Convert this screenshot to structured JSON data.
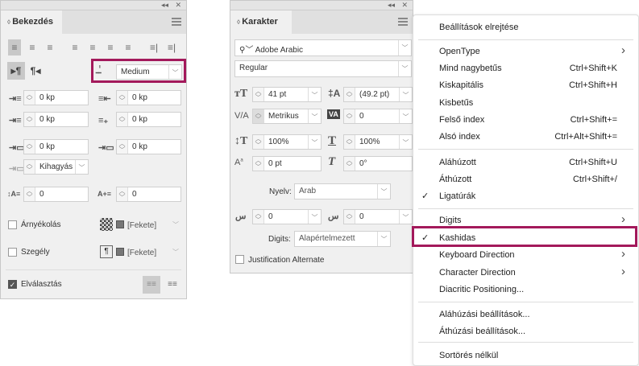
{
  "paragraph_panel": {
    "title": "Bekezdés",
    "kashida_value": "Medium",
    "left_indent": "0 kp",
    "right_indent": "0 kp",
    "first_line_indent": "0 kp",
    "last_line_indent": "0 kp",
    "space_before": "0 kp",
    "space_after": "0 kp",
    "grid_align": "Kihagyás",
    "drop_cap_lines": "0",
    "drop_cap_chars": "0",
    "shading_label": "Árnyékolás",
    "shading_color": "[Fekete]",
    "border_label": "Szegély",
    "border_color": "[Fekete]",
    "hyphenation_label": "Elválasztás"
  },
  "character_panel": {
    "title": "Karakter",
    "font_family": "Adobe Arabic",
    "font_style": "Regular",
    "font_size": "41 pt",
    "leading": "(49.2 pt)",
    "kerning": "Metrikus",
    "tracking": "0",
    "vertical_scale": "100%",
    "horizontal_scale": "100%",
    "baseline_shift": "0 pt",
    "skew": "0°",
    "language_label": "Nyelv:",
    "language": "Arab",
    "diacritic_x": "0",
    "diacritic_y": "0",
    "digits_label": "Digits:",
    "digits": "Alapértelmezett",
    "justification_alternate": "Justification Alternate"
  },
  "menu": {
    "items": [
      {
        "label": "Beállítások elrejtése",
        "shortcut": "",
        "submenu": false,
        "checked": false
      },
      {
        "label": "OpenType",
        "shortcut": "",
        "submenu": true,
        "checked": false
      },
      {
        "label": "Mind nagybetűs",
        "shortcut": "Ctrl+Shift+K",
        "submenu": false,
        "checked": false
      },
      {
        "label": "Kiskapitális",
        "shortcut": "Ctrl+Shift+H",
        "submenu": false,
        "checked": false
      },
      {
        "label": "Kisbetűs",
        "shortcut": "",
        "submenu": false,
        "checked": false
      },
      {
        "label": "Felső index",
        "shortcut": "Ctrl+Shift+=",
        "submenu": false,
        "checked": false
      },
      {
        "label": "Alsó index",
        "shortcut": "Ctrl+Alt+Shift+=",
        "submenu": false,
        "checked": false
      },
      {
        "label": "Aláhúzott",
        "shortcut": "Ctrl+Shift+U",
        "submenu": false,
        "checked": false
      },
      {
        "label": "Áthúzott",
        "shortcut": "Ctrl+Shift+/",
        "submenu": false,
        "checked": false
      },
      {
        "label": "Ligatúrák",
        "shortcut": "",
        "submenu": false,
        "checked": true
      },
      {
        "label": "Digits",
        "shortcut": "",
        "submenu": true,
        "checked": false
      },
      {
        "label": "Kashidas",
        "shortcut": "",
        "submenu": false,
        "checked": true
      },
      {
        "label": "Keyboard Direction",
        "shortcut": "",
        "submenu": true,
        "checked": false
      },
      {
        "label": "Character Direction",
        "shortcut": "",
        "submenu": true,
        "checked": false
      },
      {
        "label": "Diacritic Positioning...",
        "shortcut": "",
        "submenu": false,
        "checked": false
      },
      {
        "label": "Aláhúzási beállítások...",
        "shortcut": "",
        "submenu": false,
        "checked": false
      },
      {
        "label": "Áthúzási beállítások...",
        "shortcut": "",
        "submenu": false,
        "checked": false
      },
      {
        "label": "Sortörés nélkül",
        "shortcut": "",
        "submenu": false,
        "checked": false
      }
    ]
  },
  "highlight_color": "#a3195b"
}
